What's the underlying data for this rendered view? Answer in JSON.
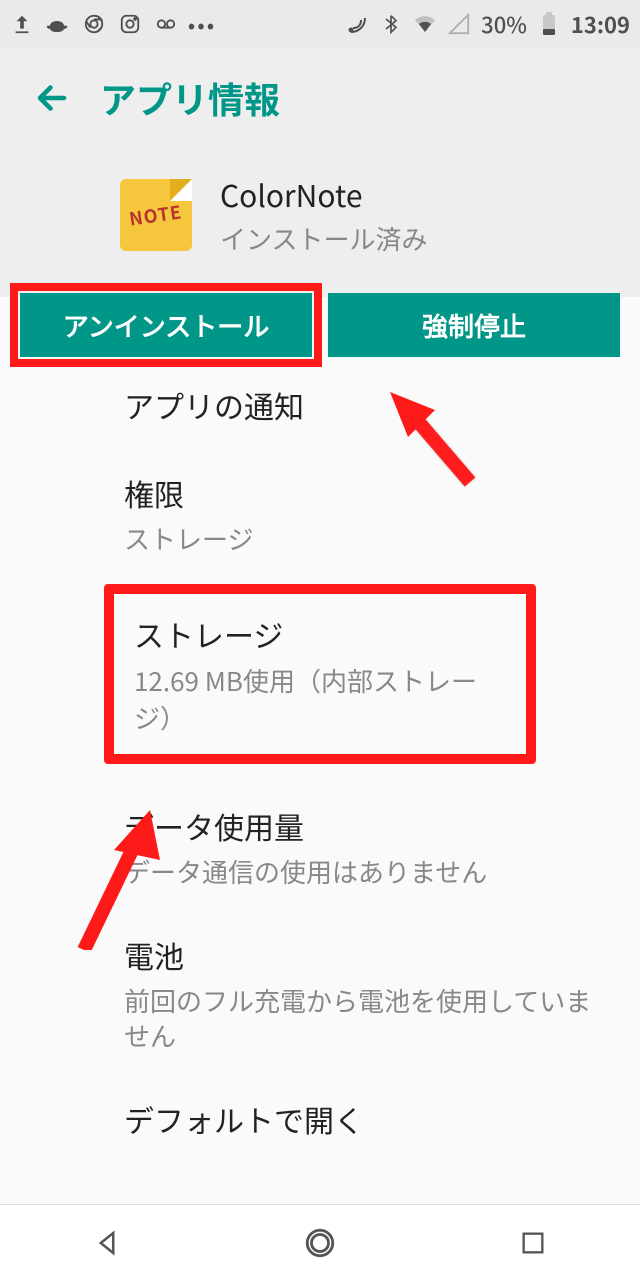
{
  "status": {
    "battery_pct": "30%",
    "time": "13:09"
  },
  "appbar": {
    "title": "アプリ情報"
  },
  "app": {
    "icon_text": "NOTE",
    "name": "ColorNote",
    "installed": "インストール済み"
  },
  "buttons": {
    "uninstall": "アンインストール",
    "force_stop": "強制停止"
  },
  "rows": {
    "notifications": {
      "title": "アプリの通知"
    },
    "permissions": {
      "title": "権限",
      "sub": "ストレージ"
    },
    "storage": {
      "title": "ストレージ",
      "sub": "12.69 MB使用（内部ストレージ）"
    },
    "data": {
      "title": "データ使用量",
      "sub": "データ通信の使用はありません"
    },
    "battery": {
      "title": "電池",
      "sub": "前回のフル充電から電池を使用していません"
    },
    "default": {
      "title": "デフォルトで開く"
    }
  }
}
